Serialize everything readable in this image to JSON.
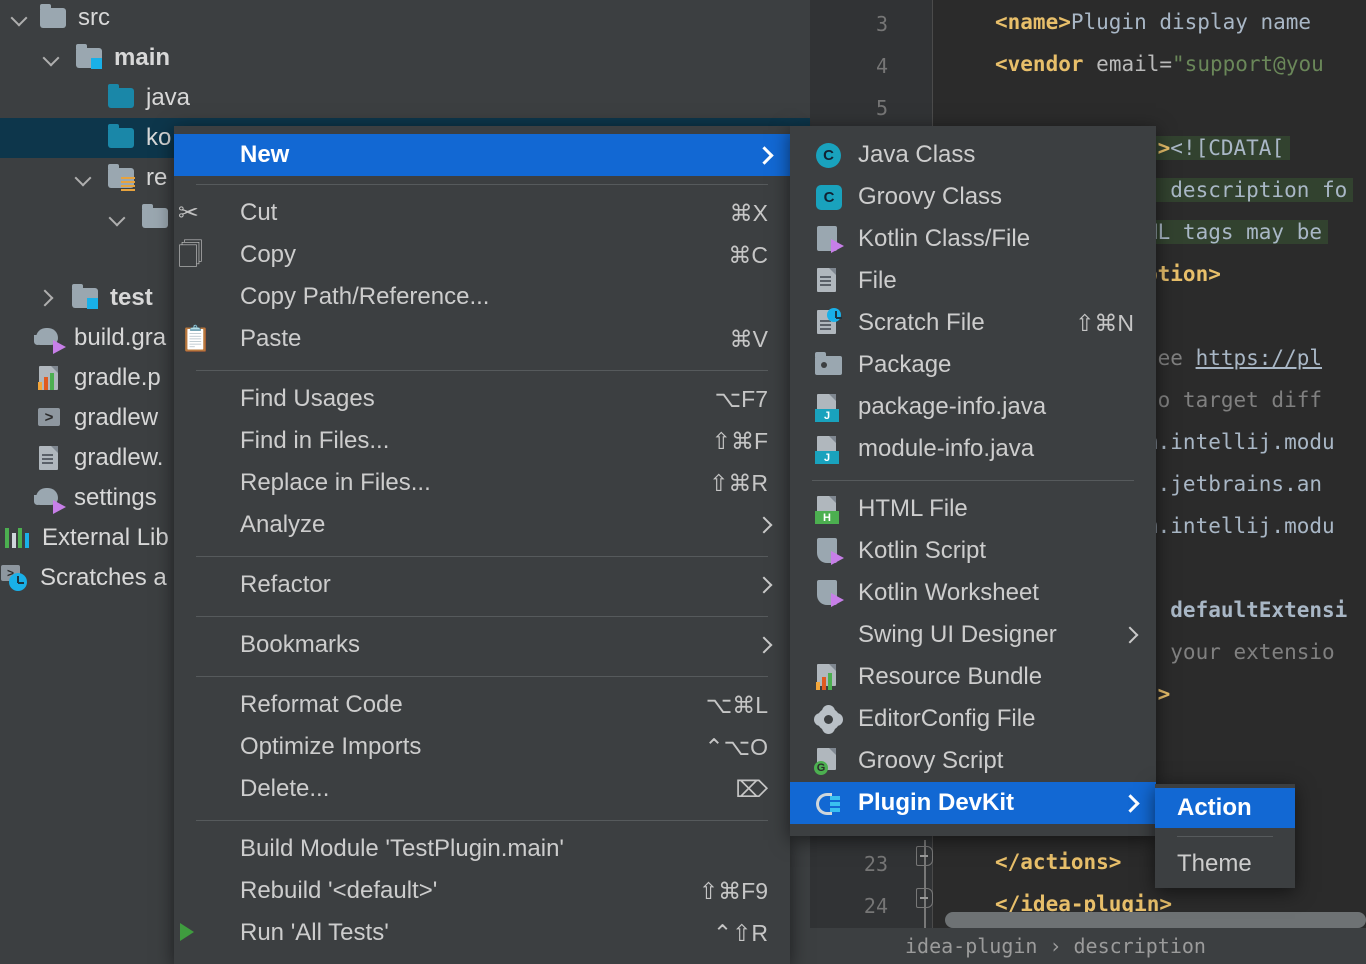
{
  "project_tree": {
    "items": [
      {
        "label": "src",
        "icon": "folder-icon",
        "indent": 30,
        "expander": "down",
        "bold": false
      },
      {
        "label": "main",
        "icon": "folder-source-icon",
        "indent": 68,
        "expander": "down",
        "bold": true
      },
      {
        "label": "java",
        "icon": "folder-blue-icon",
        "indent": 106,
        "expander": "none",
        "bold": false
      },
      {
        "label": "ko",
        "icon": "folder-blue-icon",
        "indent": 106,
        "expander": "none",
        "bold": false,
        "selected": true
      },
      {
        "label": "re",
        "icon": "folder-resources-icon",
        "indent": 68,
        "expander": "down",
        "bold": false
      },
      {
        "label": "",
        "icon": "folder-icon",
        "indent": 106,
        "expander": "down",
        "bold": false
      },
      {
        "label": "test",
        "icon": "folder-source-icon",
        "indent": 30,
        "expander": "right",
        "bold": true
      },
      {
        "label": "build.gra",
        "icon": "gradle-icon",
        "indent": 30,
        "expander": "none",
        "bold": false
      },
      {
        "label": "gradle.p",
        "icon": "properties-icon",
        "indent": 30,
        "expander": "none",
        "bold": false
      },
      {
        "label": "gradlew",
        "icon": "shell-script-icon",
        "indent": 30,
        "expander": "none",
        "bold": false
      },
      {
        "label": "gradlew.",
        "icon": "file-icon",
        "indent": 30,
        "expander": "none",
        "bold": false
      },
      {
        "label": "settings",
        "icon": "gradle-icon",
        "indent": 30,
        "expander": "none",
        "bold": false
      },
      {
        "label": "External Lib",
        "icon": "external-libraries-icon",
        "indent": 0,
        "expander": "none",
        "bold": false
      },
      {
        "label": "Scratches a",
        "icon": "scratches-icon",
        "indent": 0,
        "expander": "none",
        "bold": false
      }
    ]
  },
  "context_menu": {
    "items": [
      {
        "label": "New",
        "shortcut": "",
        "icon": "none",
        "submenu": true,
        "highlighted": true
      },
      {
        "separator_after": true
      },
      {
        "label": "Cut",
        "shortcut": "⌘X",
        "icon": "scissors-icon"
      },
      {
        "label": "Copy",
        "shortcut": "⌘C",
        "icon": "copy-icon"
      },
      {
        "label": "Copy Path/Reference...",
        "shortcut": "",
        "icon": "none"
      },
      {
        "label": "Paste",
        "shortcut": "⌘V",
        "icon": "clipboard-icon"
      },
      {
        "label": "Find Usages",
        "shortcut": "⌥F7",
        "icon": "none"
      },
      {
        "label": "Find in Files...",
        "shortcut": "⇧⌘F",
        "icon": "none"
      },
      {
        "label": "Replace in Files...",
        "shortcut": "⇧⌘R",
        "icon": "none"
      },
      {
        "label": "Analyze",
        "shortcut": "",
        "icon": "none",
        "submenu": true
      },
      {
        "label": "Refactor",
        "shortcut": "",
        "icon": "none",
        "submenu": true
      },
      {
        "label": "Bookmarks",
        "shortcut": "",
        "icon": "none",
        "submenu": true
      },
      {
        "label": "Reformat Code",
        "shortcut": "⌥⌘L",
        "icon": "none"
      },
      {
        "label": "Optimize Imports",
        "shortcut": "⌃⌥O",
        "icon": "none"
      },
      {
        "label": "Delete...",
        "shortcut": "⌦",
        "icon": "none"
      },
      {
        "label": "Build Module 'TestPlugin.main'",
        "shortcut": "",
        "icon": "none"
      },
      {
        "label": "Rebuild '<default>'",
        "shortcut": "⇧⌘F9",
        "icon": "none"
      },
      {
        "label": "Run 'All Tests'",
        "shortcut": "⌃⇧R",
        "icon": "run-icon"
      }
    ]
  },
  "new_submenu": {
    "items": [
      {
        "label": "Java Class",
        "shortcut": "",
        "icon": "java-class-icon"
      },
      {
        "label": "Groovy Class",
        "shortcut": "",
        "icon": "groovy-class-icon"
      },
      {
        "label": "Kotlin Class/File",
        "shortcut": "",
        "icon": "kotlin-file-icon"
      },
      {
        "label": "File",
        "shortcut": "",
        "icon": "file-icon"
      },
      {
        "label": "Scratch File",
        "shortcut": "⇧⌘N",
        "icon": "scratch-file-icon"
      },
      {
        "label": "Package",
        "shortcut": "",
        "icon": "package-icon"
      },
      {
        "label": "package-info.java",
        "shortcut": "",
        "icon": "java-file-icon"
      },
      {
        "label": "module-info.java",
        "shortcut": "",
        "icon": "java-file-icon"
      },
      {
        "label": "HTML File",
        "shortcut": "",
        "icon": "html-file-icon"
      },
      {
        "label": "Kotlin Script",
        "shortcut": "",
        "icon": "kotlin-script-icon"
      },
      {
        "label": "Kotlin Worksheet",
        "shortcut": "",
        "icon": "kotlin-script-icon"
      },
      {
        "label": "Swing UI Designer",
        "shortcut": "",
        "icon": "none",
        "submenu": true
      },
      {
        "label": "Resource Bundle",
        "shortcut": "",
        "icon": "resource-bundle-icon"
      },
      {
        "label": "EditorConfig File",
        "shortcut": "",
        "icon": "gear-icon"
      },
      {
        "label": "Groovy Script",
        "shortcut": "",
        "icon": "groovy-script-icon"
      },
      {
        "label": "Plugin DevKit",
        "shortcut": "",
        "icon": "plugin-devkit-icon",
        "submenu": true,
        "highlighted": true
      }
    ]
  },
  "devkit_submenu": {
    "items": [
      {
        "label": "Action",
        "highlighted": true
      },
      {
        "label": "Theme",
        "highlighted": false
      }
    ]
  },
  "editor": {
    "line_numbers": [
      "3",
      "4",
      "5",
      "23",
      "24"
    ],
    "code_lines": [
      "<name>Plugin display name",
      "<vendor email=\"support@you",
      "n><![CDATA[",
      "  description fo",
      "ML tags may be",
      "ption>",
      "see https://pl",
      "to target diff",
      "m.intellij.modu",
      "g.jetbrains.an",
      "m.intellij.modu",
      "  defaultExtensi",
      "d your extensio",
      "s>",
      "</actions>",
      "</idea-plugin>"
    ],
    "breadcrumb": [
      "idea-plugin",
      "description"
    ],
    "breadcrumb_separator": "›"
  },
  "colors": {
    "menu_bg": "#3c3f41",
    "highlight": "#1268d3",
    "editor_bg": "#2b2b2b",
    "gutter_bg": "#313335",
    "selected_row": "#0d364b",
    "tag_color": "#e8bf6a",
    "string_color": "#6a8759",
    "text_color": "#a9b7c6"
  }
}
